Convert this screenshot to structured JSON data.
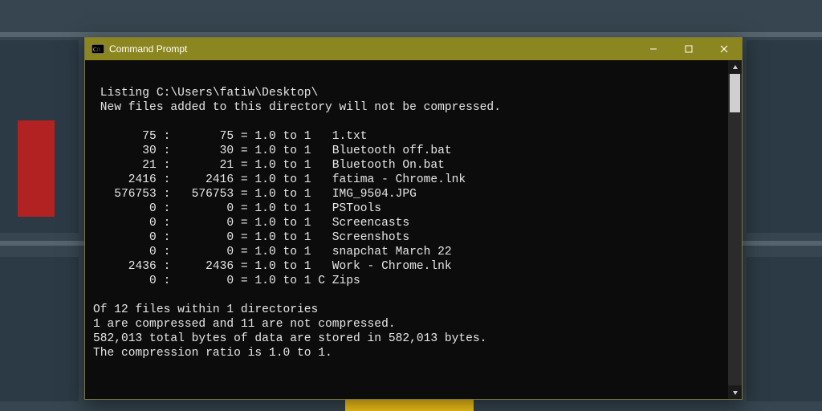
{
  "window": {
    "title": "Command Prompt"
  },
  "output": {
    "header1": "Listing C:\\Users\\fatiw\\Desktop\\",
    "header2": "New files added to this directory will not be compressed.",
    "rows": [
      {
        "size": "75",
        "stored": "75",
        "ratio": "1.0 to 1",
        "flag": " ",
        "name": "1.txt"
      },
      {
        "size": "30",
        "stored": "30",
        "ratio": "1.0 to 1",
        "flag": " ",
        "name": "Bluetooth off.bat"
      },
      {
        "size": "21",
        "stored": "21",
        "ratio": "1.0 to 1",
        "flag": " ",
        "name": "Bluetooth On.bat"
      },
      {
        "size": "2416",
        "stored": "2416",
        "ratio": "1.0 to 1",
        "flag": " ",
        "name": "fatima - Chrome.lnk"
      },
      {
        "size": "576753",
        "stored": "576753",
        "ratio": "1.0 to 1",
        "flag": " ",
        "name": "IMG_9504.JPG"
      },
      {
        "size": "0",
        "stored": "0",
        "ratio": "1.0 to 1",
        "flag": " ",
        "name": "PSTools"
      },
      {
        "size": "0",
        "stored": "0",
        "ratio": "1.0 to 1",
        "flag": " ",
        "name": "Screencasts"
      },
      {
        "size": "0",
        "stored": "0",
        "ratio": "1.0 to 1",
        "flag": " ",
        "name": "Screenshots"
      },
      {
        "size": "0",
        "stored": "0",
        "ratio": "1.0 to 1",
        "flag": " ",
        "name": "snapchat March 22"
      },
      {
        "size": "2436",
        "stored": "2436",
        "ratio": "1.0 to 1",
        "flag": " ",
        "name": "Work - Chrome.lnk"
      },
      {
        "size": "0",
        "stored": "0",
        "ratio": "1.0 to 1",
        "flag": "C",
        "name": "Zips"
      }
    ],
    "summary1": "Of 12 files within 1 directories",
    "summary2": "1 are compressed and 11 are not compressed.",
    "summary3": "582,013 total bytes of data are stored in 582,013 bytes.",
    "summary4": "The compression ratio is 1.0 to 1."
  }
}
